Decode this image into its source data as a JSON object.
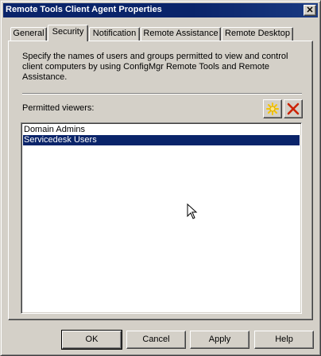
{
  "window": {
    "title": "Remote Tools Client Agent Properties",
    "close_glyph": "✕"
  },
  "tabs": [
    {
      "label": "General",
      "active": false
    },
    {
      "label": "Security",
      "active": true
    },
    {
      "label": "Notification",
      "active": false
    },
    {
      "label": "Remote Assistance",
      "active": false
    },
    {
      "label": "Remote Desktop",
      "active": false
    }
  ],
  "security": {
    "description": "Specify the names of users and groups permitted to view and control client computers by using ConfigMgr Remote Tools and Remote Assistance.",
    "viewers_label": "Permitted viewers:",
    "add_icon": "new-star-icon",
    "delete_icon": "red-x-delete-icon",
    "viewers": [
      {
        "name": "Domain Admins",
        "selected": false
      },
      {
        "name": "Servicedesk Users",
        "selected": true
      }
    ]
  },
  "buttons": {
    "ok": "OK",
    "cancel": "Cancel",
    "apply": "Apply",
    "help": "Help"
  },
  "colors": {
    "titlebar": "#0a246a",
    "face": "#d4d0c8",
    "selection": "#0a246a",
    "add_icon": "#f5c400",
    "delete_icon": "#cc2200"
  }
}
